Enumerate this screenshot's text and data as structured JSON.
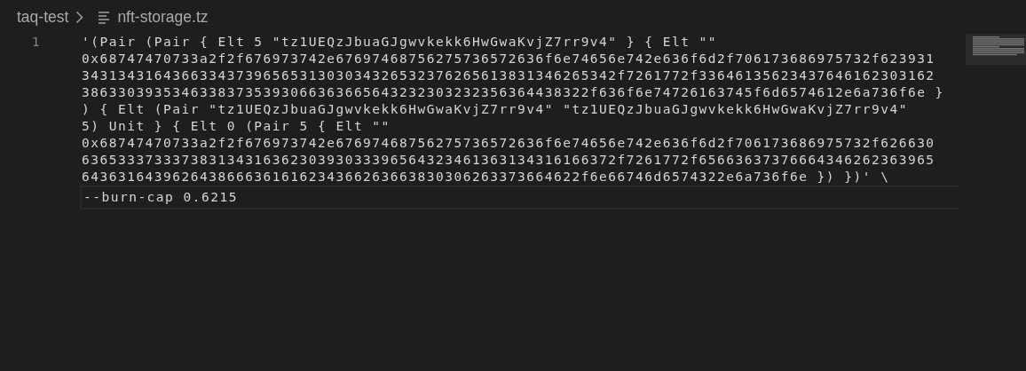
{
  "breadcrumb": [
    "taq-test",
    "nft-storage.tz"
  ],
  "editor": {
    "lines": [
      {
        "number": "1",
        "current": false,
        "rows": [
          "'(Pair (Pair { Elt 5 \"tz1UEQzJbuaGJgwvkekk6HwGwaKvjZ7rr9v4\" } { Elt \"\"",
          "0x68747470733a2f2f676973742e67697468756275736572636f6e74656e742e636f6d2f706173686975732f623931",
          "34313431643663343739656531303034326532376265613831346265342f7261772f33646135623437646162303162",
          "38633039353463383735393066363665643232303232356364438322f636f6e74726163745f6d6574612e6a736f6e }",
          ") { Elt (Pair \"tz1UEQzJbuaGJgwvkekk6HwGwaKvjZ7rr9v4\" \"tz1UEQzJbuaGJgwvkekk6HwGwaKvjZ7rr9v4\"",
          "5) Unit } { Elt 0 (Pair 5 { Elt \"\"",
          "0x68747470733a2f2f676973742e67697468756275736572636f6e74656e742e636f6d2f706173686975732f626630",
          "63653337333738313431636230393033396564323461363134316166372f7261772f65663637376664346262363965",
          "6436316439626438666361616234366263663830306263373664622f6e66746d6574322e6a736f6e }) })' \\"
        ]
      },
      {
        "current": true,
        "rows": [
          "--burn-cap 0.6215"
        ]
      }
    ]
  }
}
